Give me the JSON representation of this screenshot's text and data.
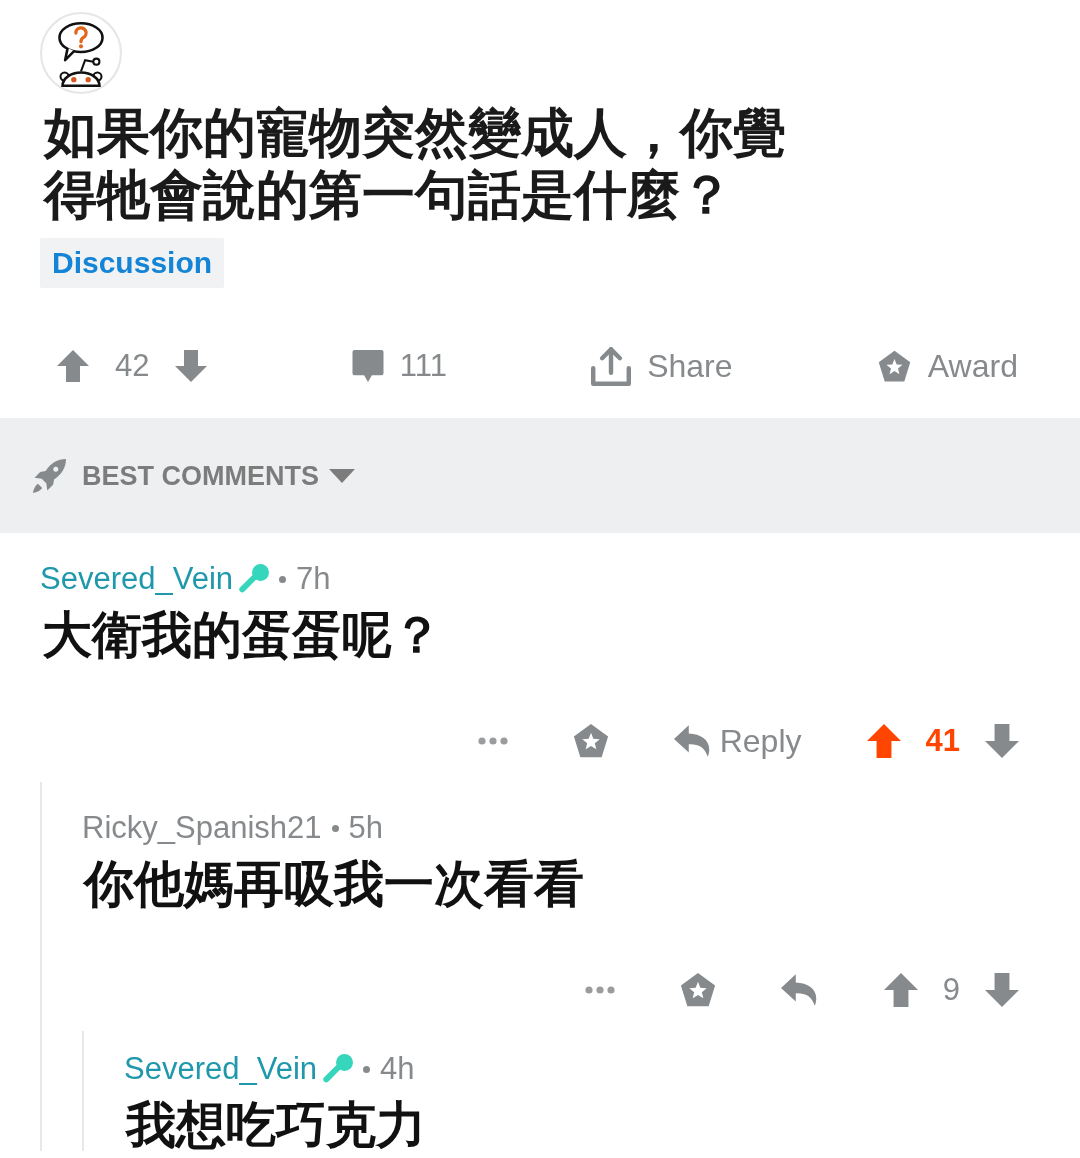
{
  "post": {
    "title": "如果你的寵物突然變成人，你覺得牠會說的第一句話是什麼？",
    "flair": "Discussion",
    "score": "42",
    "upvoted": false,
    "comments": "111",
    "share": "Share",
    "award": "Award"
  },
  "sort": {
    "label": "BEST COMMENTS"
  },
  "comments": [
    {
      "author": "Severed_Vein",
      "author_highlighted": true,
      "badge": true,
      "age": "7h",
      "body": "大衛我的蛋蛋呢？",
      "actions": {
        "reply": "Reply",
        "score": "41",
        "upvoted": true
      },
      "children": [
        {
          "author": "Ricky_Spanish21",
          "author_highlighted": false,
          "badge": false,
          "age": "5h",
          "body": "你他媽再吸我一次看看",
          "actions": {
            "score": "9",
            "upvoted": false
          },
          "children": [
            {
              "author": "Severed_Vein",
              "author_highlighted": true,
              "badge": true,
              "age": "4h",
              "body": "我想吃巧克力"
            }
          ]
        }
      ]
    }
  ]
}
